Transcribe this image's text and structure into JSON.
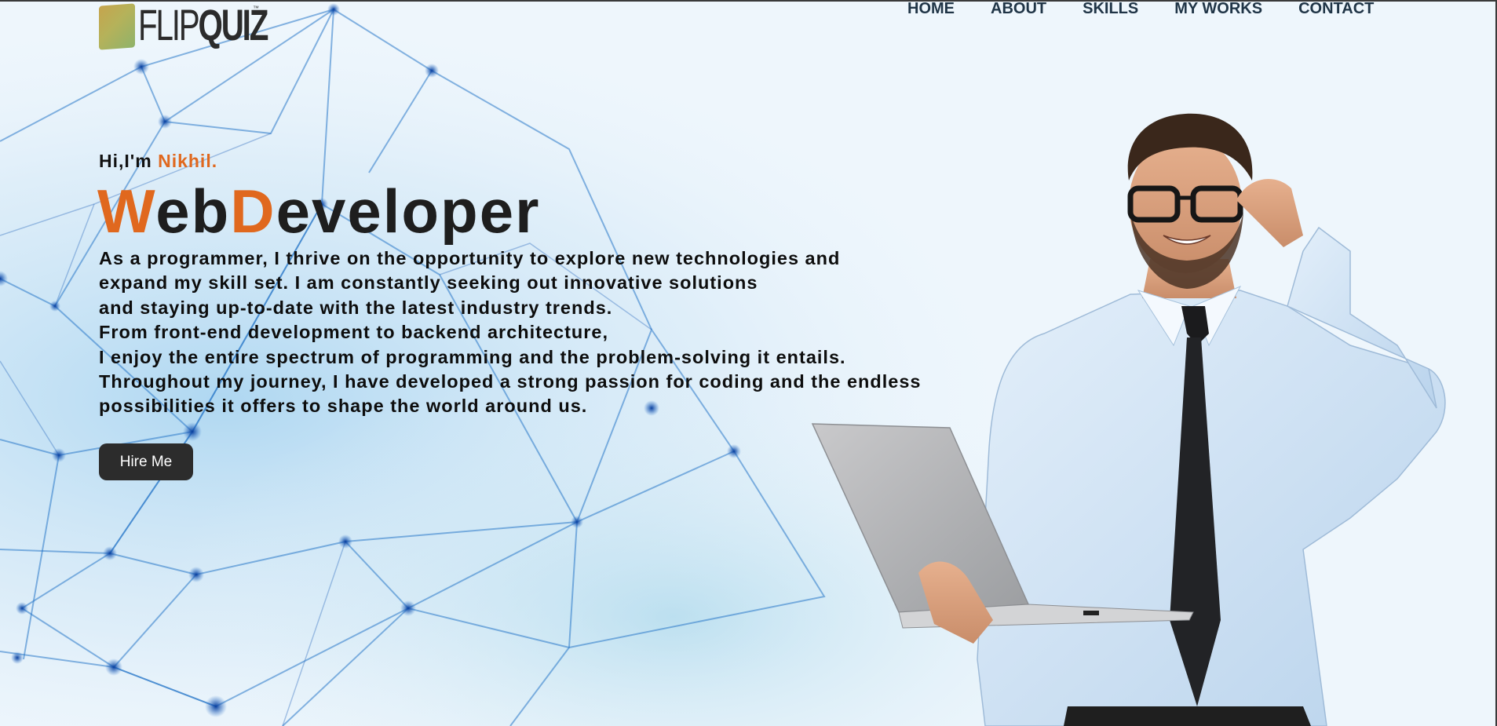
{
  "logo": {
    "text_thin": "FLIP",
    "text_bold": "QUIZ",
    "trademark": "™"
  },
  "nav": {
    "items": [
      "HOME",
      "ABOUT",
      "SKILLS",
      "MY WORKS",
      "CONTACT"
    ]
  },
  "hero": {
    "greeting": "Hi,I'm ",
    "name": "Nikhil.",
    "title_parts": [
      "W",
      "eb",
      "D",
      "eveloper"
    ],
    "bio_lines": [
      "As a programmer, I thrive on the opportunity to explore new technologies and",
      "expand my skill set. I am constantly seeking out innovative solutions",
      "and staying up-to-date with the latest industry trends.",
      "From front-end development to backend architecture,",
      "I enjoy the entire spectrum of programming and the problem-solving it entails.",
      "Throughout my journey, I have developed a strong passion for coding and the endless",
      "possibilities it offers to shape the world around us."
    ],
    "cta_label": "Hire Me"
  },
  "colors": {
    "accent": "#e0681e",
    "nav_text": "#1f3446",
    "button_bg": "#2c2c2c"
  },
  "icons": {
    "hero_image": "developer-with-laptop-photo",
    "background": "network-mesh-pattern"
  }
}
